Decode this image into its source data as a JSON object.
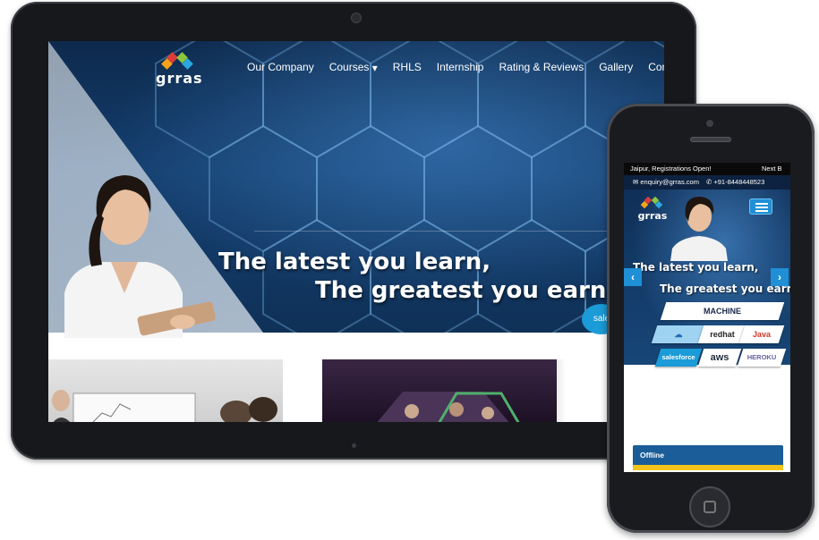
{
  "tablet": {
    "site_name": "grras",
    "nav": [
      {
        "label": "Our Company"
      },
      {
        "label": "Courses",
        "has_caret": true,
        "caret": "▾"
      },
      {
        "label": "RHLS"
      },
      {
        "label": "Internship"
      },
      {
        "label": "Rating & Reviews"
      },
      {
        "label": "Gallery"
      },
      {
        "label": "Contact Us"
      }
    ],
    "hero": {
      "headline_line1": "The latest you learn,",
      "headline_line2": "The greatest you earn.",
      "badge": "sale"
    }
  },
  "phone": {
    "ticker": "Jaipur, Registrations Open!",
    "ticker_next": "Next B",
    "email": "enquiry@grras.com",
    "phone_number": "+91-8448448523",
    "site_name": "grras",
    "hero": {
      "headline_line1": "The latest you learn,",
      "headline_line2": "The greatest you earn."
    },
    "prev_arrow": "‹",
    "next_arrow": "›",
    "logos": {
      "machine_learning": "MACHINE",
      "azure": "☁",
      "redhat": "redhat",
      "java": "Java",
      "salesforce": "salesforce",
      "aws": "aws",
      "heroku": "HEROKU"
    },
    "chat_status": "Offline"
  },
  "colors": {
    "accent_blue": "#1f8fd6",
    "hero_navy": "#0f3158",
    "chat_bar": "#1a5d99",
    "chat_stripe": "#f3c319"
  }
}
